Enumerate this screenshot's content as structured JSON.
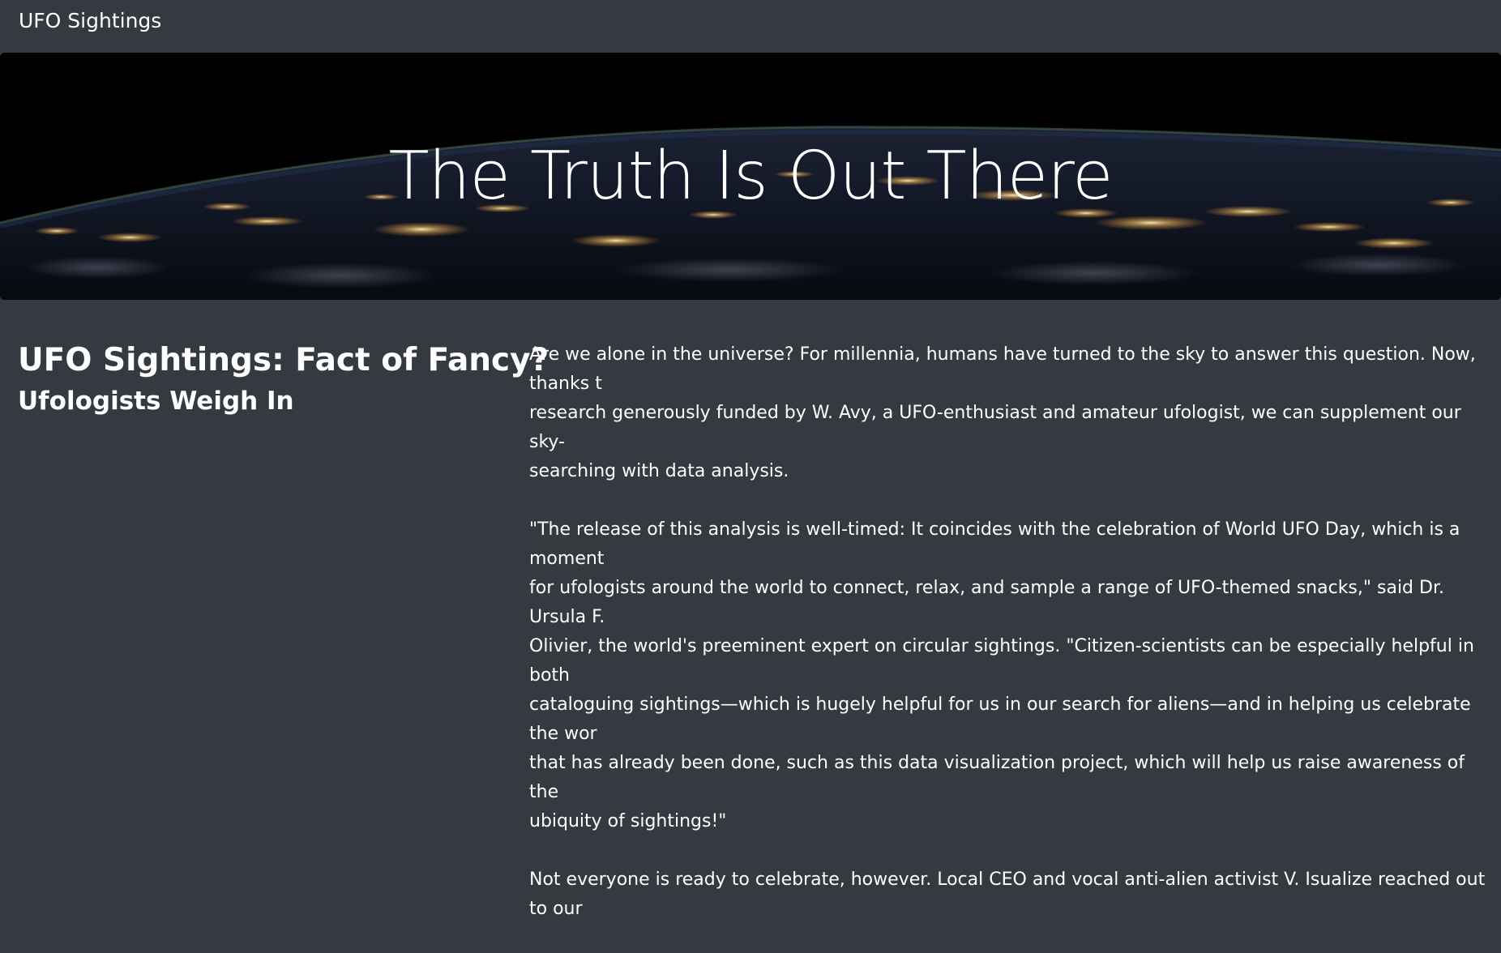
{
  "navbar": {
    "brand": "UFO Sightings"
  },
  "hero": {
    "title": "The Truth Is Out There"
  },
  "main": {
    "headline": "UFO Sightings: Fact of Fancy?",
    "subheadline": "Ufologists Weigh In",
    "paragraphs": [
      "Are we alone in the universe? For millennia, humans have turned to the sky to answer this question. Now, thanks t\nresearch generously funded by W. Avy, a UFO-enthusiast and amateur ufologist, we can supplement our sky-\nsearching with data analysis.",
      "\"The release of this analysis is well-timed: It coincides with the celebration of World UFO Day, which is a moment\nfor ufologists around the world to connect, relax, and sample a range of UFO-themed snacks,\" said Dr. Ursula F.\nOlivier, the world's preeminent expert on circular sightings. \"Citizen-scientists can be especially helpful in both\ncataloguing sightings—which is hugely helpful for us in our search for aliens—and in helping us celebrate the wor\nthat has already been done, such as this data visualization project, which will help us raise awareness of the\nubiquity of sightings!\"",
      "Not everyone is ready to celebrate, however. Local CEO and vocal anti-alien activist V. Isualize reached out to our"
    ]
  },
  "colors": {
    "background": "#343a40",
    "text": "#ffffff",
    "city_lights": "#ffd27a"
  }
}
